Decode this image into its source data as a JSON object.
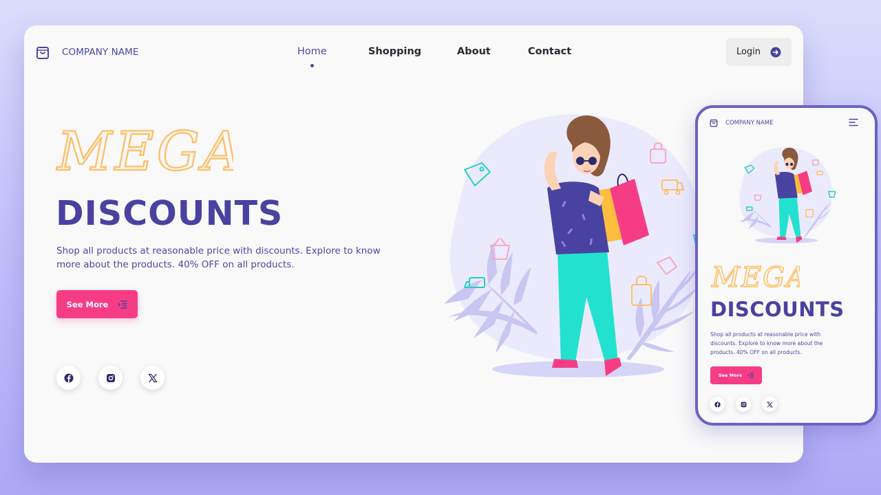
{
  "colors": {
    "brand_purple": "#4a42a0",
    "accent_pink": "#f73c86",
    "mega_yellow": "#fdc06a",
    "card_bg": "#f9f9f9"
  },
  "desktop": {
    "logo_icon": "shopping-bag-icon",
    "company_name": "COMPANY NAME",
    "nav": {
      "items": [
        {
          "label": "Home",
          "active": true
        },
        {
          "label": "Shopping",
          "active": false
        },
        {
          "label": "About",
          "active": false
        },
        {
          "label": "Contact",
          "active": false
        }
      ]
    },
    "login": {
      "label": "Login",
      "icon": "arrow-right-circle-icon"
    },
    "hero": {
      "mega": "MEGA",
      "headline": "DISCOUNTS",
      "description": "Shop all products at reasonable price with discounts. Explore to know more about the products. 40% OFF on all products.",
      "cta_label": "See More",
      "cta_icon": "list-indent-icon"
    },
    "social": [
      "facebook-icon",
      "instagram-icon",
      "x-icon"
    ]
  },
  "mobile": {
    "company_name": "COMPANY NAME",
    "menu_icon": "hamburger-menu-icon",
    "hero": {
      "mega": "MEGA",
      "headline": "DISCOUNTS",
      "description": "Shop all products at reasonable price with discounts. Explore to know more about the products. 40% OFF on all products.",
      "cta_label": "See More"
    },
    "social": [
      "facebook-icon",
      "instagram-icon",
      "x-icon"
    ]
  }
}
